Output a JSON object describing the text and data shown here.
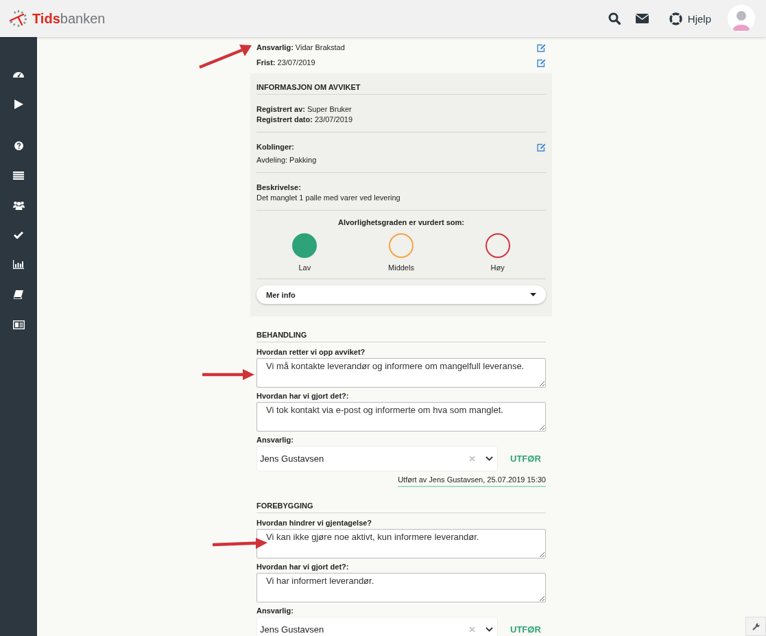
{
  "header": {
    "logo": {
      "part1": "Tids",
      "part2": "banken"
    },
    "help": "Hjelp"
  },
  "summary": [
    {
      "label": "Ansvarlig:",
      "value": "Vidar Brakstad"
    },
    {
      "label": "Frist:",
      "value": "23/07/2019"
    }
  ],
  "info": {
    "title": "INFORMASJON OM AVVIKET",
    "registered": [
      {
        "label": "Registrert av:",
        "value": "Super Bruker"
      },
      {
        "label": "Registrert dato:",
        "value": "23/07/2019"
      }
    ],
    "links_label": "Koblinger:",
    "links": [
      {
        "label": "Avdeling:",
        "value": "Pakking"
      }
    ],
    "description_label": "Beskrivelse:",
    "description": "Det manglet 1 palle med varer ved levering",
    "severity_title": "Alvorlighetsgraden er vurdert som:",
    "severity": [
      {
        "label": "Lav",
        "color": "#2ea37a",
        "selected": true
      },
      {
        "label": "Middels",
        "color": "#f5a445",
        "selected": false
      },
      {
        "label": "Høy",
        "color": "#d23440",
        "selected": false
      }
    ],
    "more": "Mer info"
  },
  "sections": [
    {
      "title": "BEHANDLING",
      "questions": [
        {
          "label": "Hvordan retter vi opp avviket?",
          "value": "Vi må kontakte leverandør og informere om mangelfull leveranse."
        },
        {
          "label": "Hvordan har vi gjort det?:",
          "value": "Vi tok kontakt via e-post og informerte om hva som manglet."
        }
      ],
      "responsible_label": "Ansvarlig:",
      "responsible": "Jens Gustavsen",
      "action": "UTFØR",
      "done_note": "Utført av Jens Gustavsen, 25.07.2019 15:30"
    },
    {
      "title": "FOREBYGGING",
      "questions": [
        {
          "label": "Hvordan hindrer vi gjentagelse?",
          "value": "Vi kan ikke gjøre noe aktivt, kun informere leverandør."
        },
        {
          "label": "Hvordan har vi gjort det?:",
          "value": "Vi har informert leverandør."
        }
      ],
      "responsible_label": "Ansvarlig:",
      "responsible": "Jens Gustavsen",
      "action": "UTFØR"
    }
  ]
}
